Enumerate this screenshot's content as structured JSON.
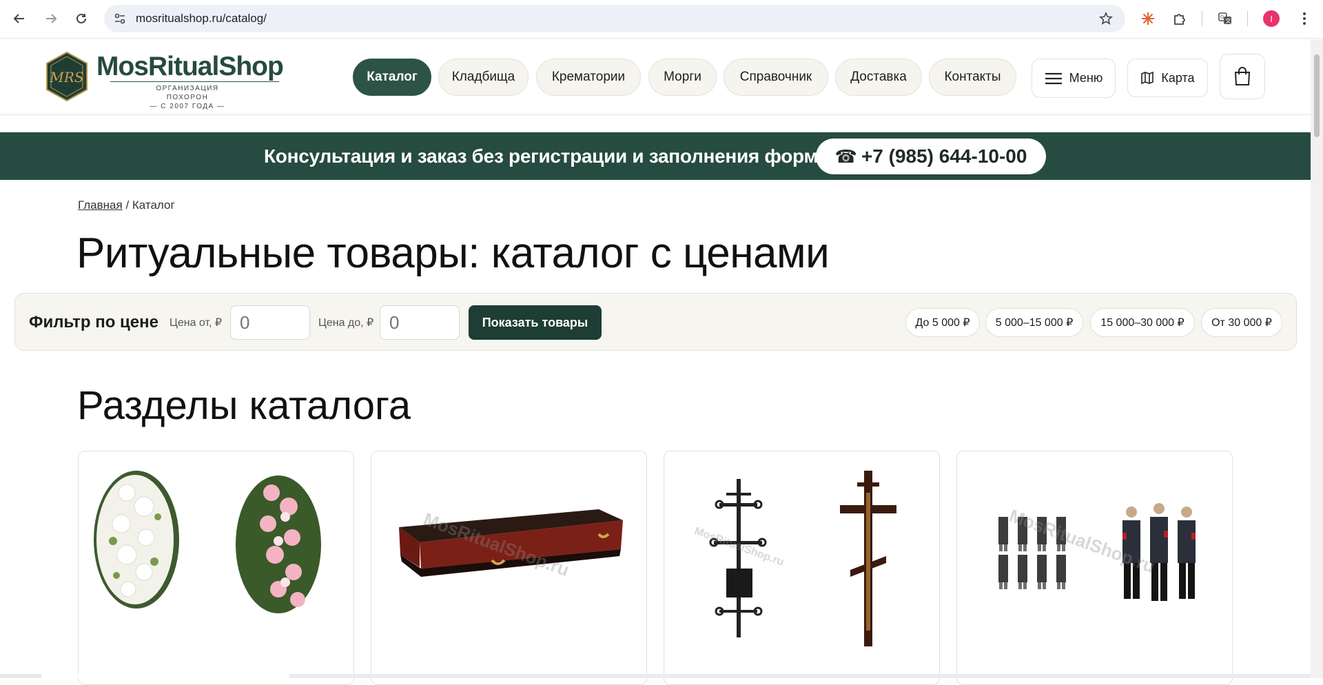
{
  "browser": {
    "url": "mosritualshop.ru/catalog/",
    "avatar_letter": "I",
    "icons": [
      "back-arrow-icon",
      "forward-arrow-icon",
      "reload-icon",
      "site-info-icon",
      "bookmark-star-icon",
      "extension-icon",
      "puzzle-icon",
      "translate-icon",
      "kebab-menu-icon"
    ]
  },
  "header": {
    "logo_name": "MosRitualShop",
    "logo_monogram": "MRS",
    "logo_tagline_1": "ОРГАНИЗАЦИЯ ПОХОРОН",
    "logo_tagline_2": "— С 2007 ГОДА —",
    "nav": [
      "Каталог",
      "Кладбища",
      "Крематории",
      "Морги",
      "Справочник",
      "Доставка",
      "Контакты"
    ],
    "menu_label": "Меню",
    "map_label": "Карта"
  },
  "banner": {
    "text": "Консультация и заказ без регистрации и заполнения форм",
    "phone": "+7 (985) 644-10-00"
  },
  "breadcrumb": {
    "home": "Главная",
    "separator": " / ",
    "current": "Каталог"
  },
  "page_title": "Ритуальные товары: каталог с ценами",
  "filter": {
    "title": "Фильтр по цене",
    "from_label": "Цена от, ₽",
    "from_placeholder": "0",
    "to_label": "Цена до, ₽",
    "to_placeholder": "0",
    "submit": "Показать товары",
    "chips": [
      "До 5 000 ₽",
      "5 000–15 000 ₽",
      "15 000–30 000 ₽",
      "От 30 000 ₽"
    ]
  },
  "sections_title": "Разделы каталога",
  "watermark": "MosRitualShop.ru",
  "colors": {
    "brand_green": "#2c5346",
    "banner_green": "#264b40",
    "button_dark": "#1e3d34",
    "pill_bg": "#f5f4ef"
  }
}
